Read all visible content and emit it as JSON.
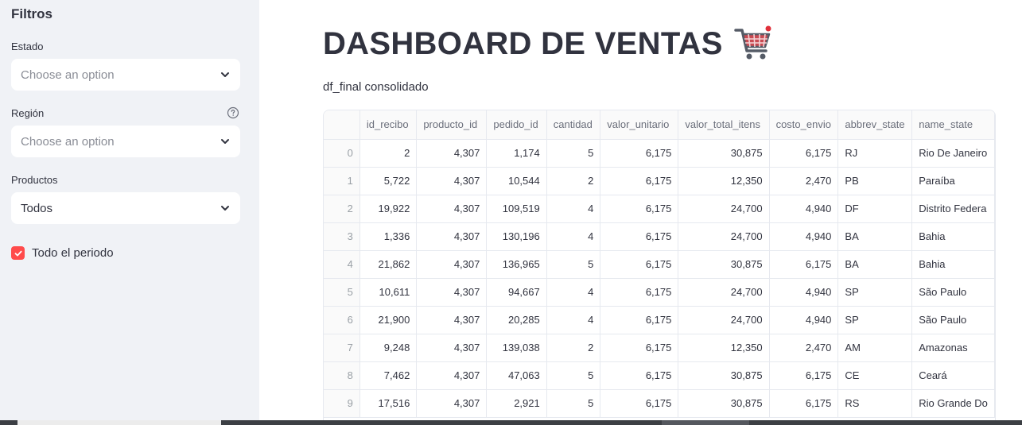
{
  "sidebar": {
    "title": "Filtros",
    "estado": {
      "label": "Estado",
      "placeholder": "Choose an option"
    },
    "region": {
      "label": "Región",
      "placeholder": "Choose an option"
    },
    "productos": {
      "label": "Productos",
      "value": "Todos"
    },
    "periodo": {
      "label": "Todo el periodo",
      "checked": true
    }
  },
  "main": {
    "title": "DASHBOARD DE VENTAS",
    "subtitle": "df_final consolidado"
  },
  "table": {
    "columns": [
      "",
      "id_recibo",
      "producto_id",
      "pedido_id",
      "cantidad",
      "valor_unitario",
      "valor_total_itens",
      "costo_envio",
      "abbrev_state",
      "name_state"
    ],
    "rows": [
      [
        "0",
        "2",
        "4,307",
        "1,174",
        "5",
        "6,175",
        "30,875",
        "6,175",
        "RJ",
        "Rio De Janeiro"
      ],
      [
        "1",
        "5,722",
        "4,307",
        "10,544",
        "2",
        "6,175",
        "12,350",
        "2,470",
        "PB",
        "Paraíba"
      ],
      [
        "2",
        "19,922",
        "4,307",
        "109,519",
        "4",
        "6,175",
        "24,700",
        "4,940",
        "DF",
        "Distrito Federa"
      ],
      [
        "3",
        "1,336",
        "4,307",
        "130,196",
        "4",
        "6,175",
        "24,700",
        "4,940",
        "BA",
        "Bahia"
      ],
      [
        "4",
        "21,862",
        "4,307",
        "136,965",
        "5",
        "6,175",
        "30,875",
        "6,175",
        "BA",
        "Bahia"
      ],
      [
        "5",
        "10,611",
        "4,307",
        "94,667",
        "4",
        "6,175",
        "24,700",
        "4,940",
        "SP",
        "São Paulo"
      ],
      [
        "6",
        "21,900",
        "4,307",
        "20,285",
        "4",
        "6,175",
        "24,700",
        "4,940",
        "SP",
        "São Paulo"
      ],
      [
        "7",
        "9,248",
        "4,307",
        "139,038",
        "2",
        "6,175",
        "12,350",
        "2,470",
        "AM",
        "Amazonas"
      ],
      [
        "8",
        "7,462",
        "4,307",
        "47,063",
        "5",
        "6,175",
        "30,875",
        "6,175",
        "CE",
        "Ceará"
      ],
      [
        "9",
        "17,516",
        "4,307",
        "2,921",
        "5",
        "6,175",
        "30,875",
        "6,175",
        "RS",
        "Rio Grande Do"
      ]
    ]
  },
  "icons": {
    "help": "help-circle-icon",
    "chevron": "chevron-down-icon",
    "check": "check-icon",
    "cart": "shopping-cart-icon"
  },
  "colors": {
    "accent": "#ff4b4b",
    "sidebar_bg": "#f0f2f6",
    "text": "#31333f"
  }
}
